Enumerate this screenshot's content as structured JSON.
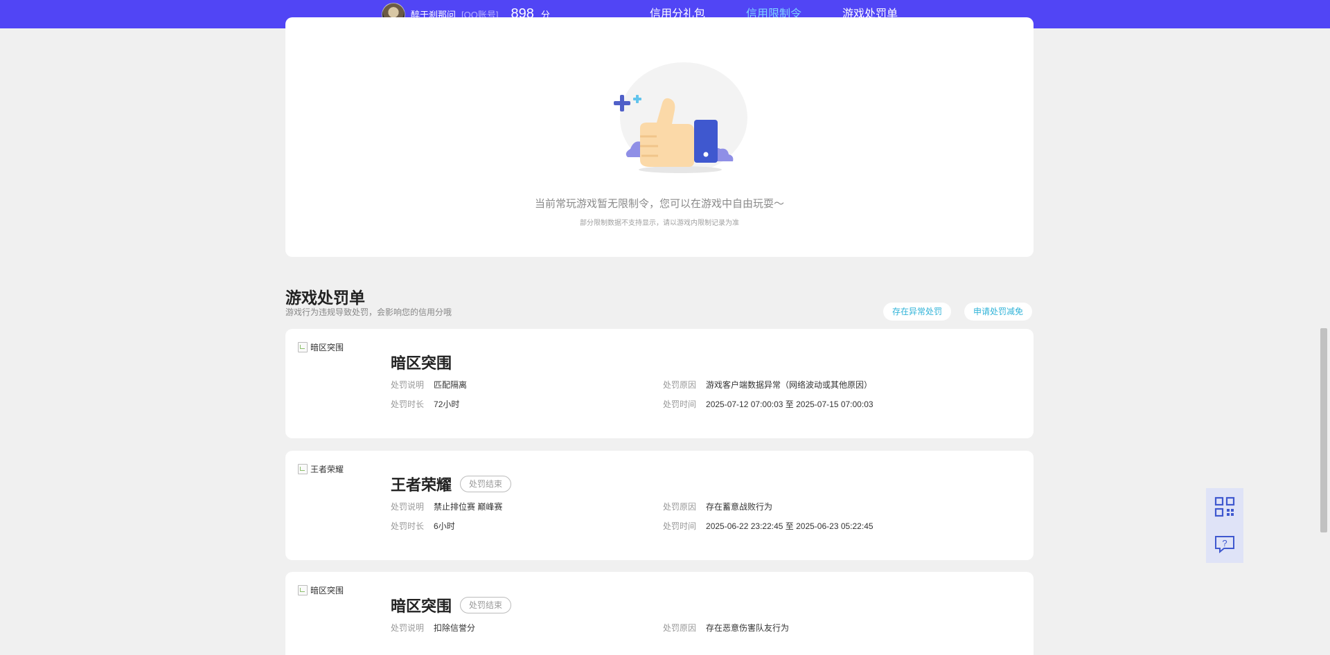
{
  "header": {
    "username": "醉于刹那问",
    "account_type": "[QQ账号]",
    "score": "898",
    "score_unit": "分",
    "nav": [
      {
        "label": "信用分礼包"
      },
      {
        "label": "信用限制令"
      },
      {
        "label": "游戏处罚单"
      }
    ],
    "active_tab": "信用限制令"
  },
  "restriction": {
    "empty_text": "当前常玩游戏暂无限制令，您可以在游戏中自由玩耍～",
    "empty_sub": "部分限制数据不支持显示，请以游戏内限制记录为准"
  },
  "penalty_section": {
    "title": "游戏处罚单",
    "subtitle": "游戏行为违规导致处罚，会影响您的信用分哦",
    "btn_abnormal": "存在异常处罚",
    "btn_appeal": "申请处罚减免",
    "labels": {
      "desc": "处罚说明",
      "duration": "处罚时长",
      "reason": "处罚原因",
      "time": "处罚时间"
    },
    "items": [
      {
        "img_alt": "暗区突围",
        "game": "暗区突围",
        "status": "",
        "desc": "匹配隔离",
        "duration": "72小时",
        "reason": "游戏客户端数据异常（网络波动或其他原因）",
        "time": "2025-07-12 07:00:03 至 2025-07-15 07:00:03"
      },
      {
        "img_alt": "王者荣耀",
        "game": "王者荣耀",
        "status": "处罚结束",
        "desc": "禁止排位赛 巅峰赛",
        "duration": "6小时",
        "reason": "存在蓄意战败行为",
        "time": "2025-06-22 23:22:45 至 2025-06-23 05:22:45"
      },
      {
        "img_alt": "暗区突围",
        "game": "暗区突围",
        "status": "处罚结束",
        "desc": "扣除信誉分",
        "duration": "",
        "reason": "存在恶意伤害队友行为",
        "time": ""
      }
    ]
  },
  "side": {
    "icons": [
      "qrcode-icon",
      "feedback-icon"
    ]
  },
  "colors": {
    "topbar": "#5145f5",
    "accent": "#30b3d8",
    "active_tab": "#7fd4ff"
  }
}
